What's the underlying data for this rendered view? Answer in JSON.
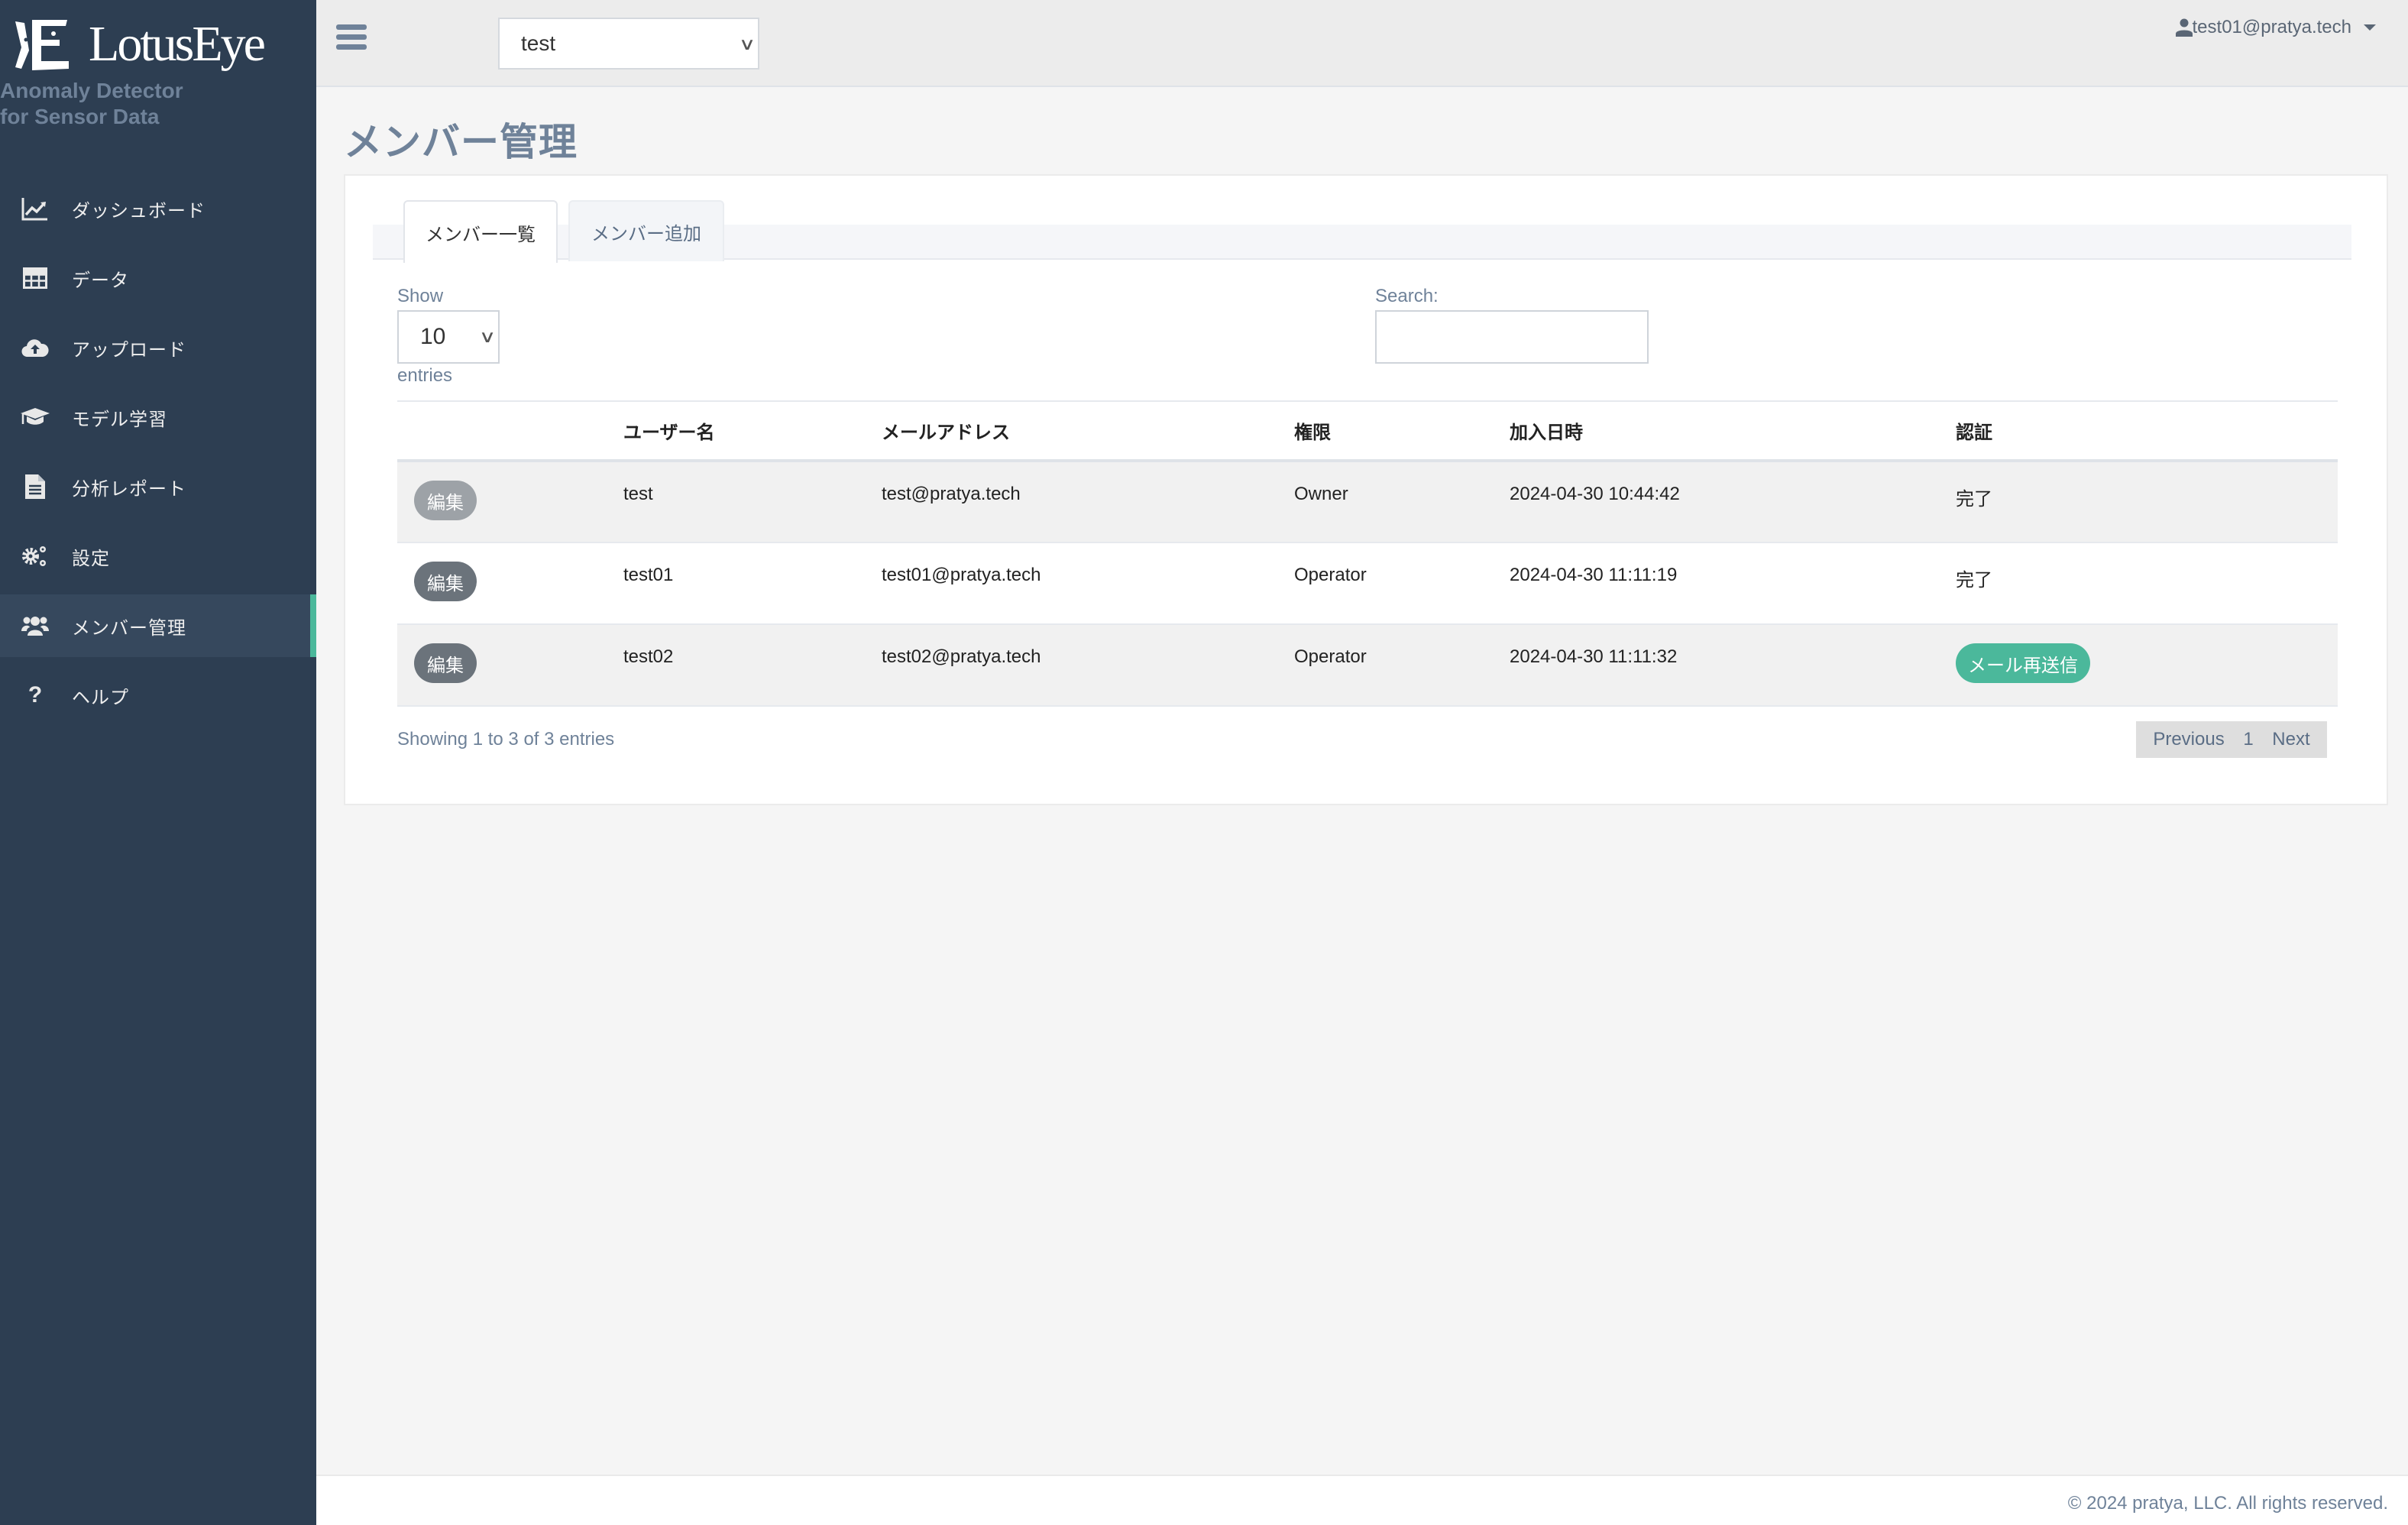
{
  "brand": {
    "name": "LotusEye",
    "tagline_line1": "Anomaly Detector",
    "tagline_line2": "for Sensor Data"
  },
  "sidebar": {
    "items": [
      {
        "label": "ダッシュボード",
        "icon": "line-chart-icon",
        "active": false
      },
      {
        "label": "データ",
        "icon": "table-icon",
        "active": false
      },
      {
        "label": "アップロード",
        "icon": "cloud-upload-icon",
        "active": false
      },
      {
        "label": "モデル学習",
        "icon": "graduation-cap-icon",
        "active": false
      },
      {
        "label": "分析レポート",
        "icon": "document-icon",
        "active": false
      },
      {
        "label": "設定",
        "icon": "gears-icon",
        "active": false
      },
      {
        "label": "メンバー管理",
        "icon": "users-icon",
        "active": true
      },
      {
        "label": "ヘルプ",
        "icon": "question-icon",
        "active": false
      }
    ],
    "accent_color": "#4bb89b"
  },
  "topbar": {
    "project_selected": "test",
    "user_email": "test01@pratya.tech"
  },
  "page": {
    "title": "メンバー管理",
    "tabs": [
      {
        "label": "メンバー一覧",
        "active": true
      },
      {
        "label": "メンバー追加",
        "active": false
      }
    ]
  },
  "table_controls": {
    "show_label": "Show",
    "page_length": "10",
    "entries_label": "entries",
    "search_label": "Search:",
    "search_value": ""
  },
  "members_table": {
    "columns": [
      "",
      "ユーザー名",
      "メールアドレス",
      "権限",
      "加入日時",
      "認証"
    ],
    "rows": [
      {
        "action": "編集",
        "action_disabled": true,
        "username": "test",
        "email": "test@pratya.tech",
        "role": "Owner",
        "joined": "2024-04-30 10:44:42",
        "auth": "完了",
        "auth_is_button": false
      },
      {
        "action": "編集",
        "action_disabled": false,
        "username": "test01",
        "email": "test01@pratya.tech",
        "role": "Operator",
        "joined": "2024-04-30 11:11:19",
        "auth": "完了",
        "auth_is_button": false
      },
      {
        "action": "編集",
        "action_disabled": false,
        "username": "test02",
        "email": "test02@pratya.tech",
        "role": "Operator",
        "joined": "2024-04-30 11:11:32",
        "auth": "メール再送信",
        "auth_is_button": true
      }
    ]
  },
  "pagination": {
    "info": "Showing 1 to 3 of 3 entries",
    "previous": "Previous",
    "current": "1",
    "next": "Next"
  },
  "footer": {
    "copyright": "© 2024 pratya, LLC. All rights reserved."
  }
}
